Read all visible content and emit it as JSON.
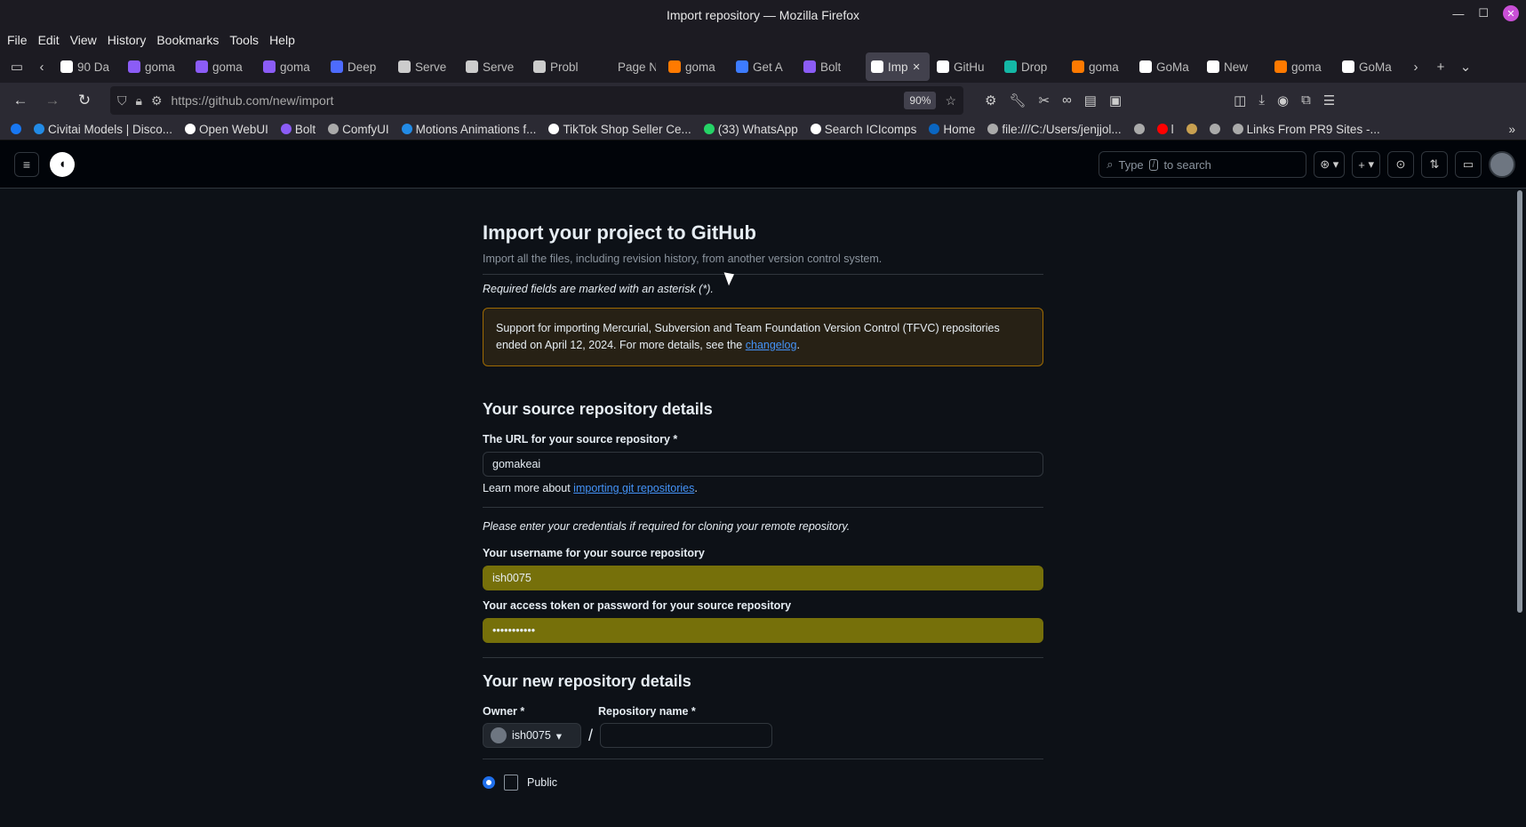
{
  "window": {
    "title": "Import repository — Mozilla Firefox"
  },
  "menu": [
    "File",
    "Edit",
    "View",
    "History",
    "Bookmarks",
    "Tools",
    "Help"
  ],
  "tabs": [
    {
      "label": "90 Da",
      "icon": "90d-icon",
      "color": "#ffffff"
    },
    {
      "label": "goma",
      "icon": "bolt-icon",
      "color": "#8b5cf6"
    },
    {
      "label": "goma",
      "icon": "bolt-icon",
      "color": "#8b5cf6"
    },
    {
      "label": "goma",
      "icon": "bolt-icon",
      "color": "#8b5cf6"
    },
    {
      "label": "Deep",
      "icon": "deepseek-icon",
      "color": "#4d6bfe"
    },
    {
      "label": "Serve",
      "icon": "info-icon",
      "color": "#cccccc"
    },
    {
      "label": "Serve",
      "icon": "info-icon",
      "color": "#cccccc"
    },
    {
      "label": "Probl",
      "icon": "info-icon",
      "color": "#cccccc"
    },
    {
      "label": "Page Not",
      "icon": "blank-icon",
      "color": "#1c1b22"
    },
    {
      "label": "goma",
      "icon": "flame-icon",
      "color": "#ff7a00"
    },
    {
      "label": "Get A",
      "icon": "dropbox-icon",
      "color": "#3d7cff"
    },
    {
      "label": "Bolt",
      "icon": "bolt-icon",
      "color": "#8b5cf6"
    },
    {
      "label": "Imp",
      "icon": "github-icon",
      "color": "#ffffff",
      "active": true
    },
    {
      "label": "GitHu",
      "icon": "github-icon",
      "color": "#ffffff"
    },
    {
      "label": "Drop",
      "icon": "diamond-icon",
      "color": "#14b8a6"
    },
    {
      "label": "goma",
      "icon": "flame-icon",
      "color": "#ff7a00"
    },
    {
      "label": "GoMa",
      "icon": "triangle-icon",
      "color": "#ffffff"
    },
    {
      "label": "New",
      "icon": "triangle-icon",
      "color": "#ffffff"
    },
    {
      "label": "goma",
      "icon": "flame-icon",
      "color": "#ff7a00"
    },
    {
      "label": "GoMa",
      "icon": "triangle-icon",
      "color": "#ffffff"
    }
  ],
  "nav": {
    "url": "https://github.com/new/import",
    "zoom": "90%"
  },
  "bookmarks": [
    {
      "label": "",
      "icon": "facebook-icon",
      "color": "#1877f2"
    },
    {
      "label": "Civitai Models | Disco...",
      "icon": "civitai-icon",
      "color": "#228be6"
    },
    {
      "label": "Open WebUI",
      "icon": "openwebui-icon",
      "color": "#ffffff"
    },
    {
      "label": "Bolt",
      "icon": "bolt-icon",
      "color": "#8b5cf6"
    },
    {
      "label": "ComfyUI",
      "icon": "globe-icon",
      "color": "#aaaaaa"
    },
    {
      "label": "Motions Animations f...",
      "icon": "civitai-icon",
      "color": "#228be6"
    },
    {
      "label": "TikTok Shop Seller Ce...",
      "icon": "tiktok-icon",
      "color": "#ffffff"
    },
    {
      "label": "(33) WhatsApp",
      "icon": "whatsapp-icon",
      "color": "#25d366"
    },
    {
      "label": "Search ICIcomps",
      "icon": "ri-icon",
      "color": "#ffffff"
    },
    {
      "label": "Home",
      "icon": "linkedin-icon",
      "color": "#0a66c2"
    },
    {
      "label": "file:///C:/Users/jenjjol...",
      "icon": "globe-icon",
      "color": "#aaaaaa"
    },
    {
      "label": "",
      "icon": "globe-icon",
      "color": "#aaaaaa"
    },
    {
      "label": "l",
      "icon": "youtube-icon",
      "color": "#ff0000"
    },
    {
      "label": "",
      "icon": "tools-icon",
      "color": "#c8a050"
    },
    {
      "label": "",
      "icon": "globe-icon",
      "color": "#aaaaaa"
    },
    {
      "label": "Links From PR9 Sites -...",
      "icon": "globe-icon",
      "color": "#aaaaaa"
    }
  ],
  "github": {
    "search_placeholder": "Type",
    "search_key": "/",
    "search_suffix": "to search"
  },
  "page": {
    "title": "Import your project to GitHub",
    "subtitle": "Import all the files, including revision history, from another version control system.",
    "required_note": "Required fields are marked with an asterisk (*).",
    "notice_text": "Support for importing Mercurial, Subversion and Team Foundation Version Control (TFVC) repositories ended on April 12, 2024. For more details, see the",
    "notice_link": "changelog",
    "source_heading": "Your source repository details",
    "url_label": "The URL for your source repository *",
    "url_value": "gomakeai",
    "learn_prefix": "Learn more about",
    "learn_link": "importing git repositories",
    "creds_note": "Please enter your credentials if required for cloning your remote repository.",
    "username_label": "Your username for your source repository",
    "username_value": "ish0075",
    "token_label": "Your access token or password for your source repository",
    "token_value": "•••••••••••",
    "new_heading": "Your new repository details",
    "owner_label": "Owner *",
    "repo_label": "Repository name *",
    "owner_value": "ish0075",
    "public_label": "Public"
  }
}
